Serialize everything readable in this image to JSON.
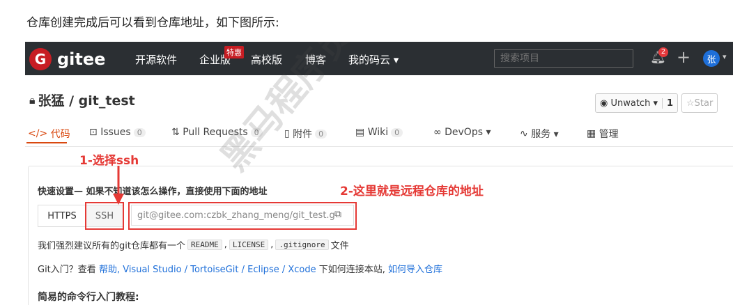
{
  "intro_text": "仓库创建完成后可以看到仓库地址，如下图所示:",
  "nav": {
    "logo_letter": "G",
    "logo_text": "gitee",
    "items": [
      "开源软件",
      "企业版",
      "高校版",
      "博客",
      "我的码云 ▾"
    ],
    "tag": "特惠",
    "search_placeholder": "搜索项目",
    "notification_count": "2",
    "avatar_letter": "张"
  },
  "repo": {
    "name": "张猛 / git_test",
    "watch_label": "Unwatch ▾",
    "watch_count": "1",
    "star_label": "Star"
  },
  "tabs": [
    {
      "label": "代码"
    },
    {
      "label": "Issues",
      "count": "0"
    },
    {
      "label": "Pull Requests",
      "count": "0"
    },
    {
      "label": "附件",
      "count": "0"
    },
    {
      "label": "Wiki",
      "count": "0"
    },
    {
      "label": "DevOps ▾"
    },
    {
      "label": "服务 ▾"
    },
    {
      "label": "管理"
    }
  ],
  "quick_setup": {
    "title": "快速设置— 如果不知道该怎么操作，直接使用下面的地址",
    "https_label": "HTTPS",
    "ssh_label": "SSH",
    "url": "git@gitee.com:czbk_zhang_meng/git_test.g",
    "suggest_prefix": "我们强烈建议所有的git仓库都有一个",
    "files": [
      "README",
      "LICENSE",
      ".gitignore"
    ],
    "suggest_suffix": "文件",
    "help_prefix": "Git入门？查看",
    "help_link": "帮助",
    "tools": ", Visual Studio / TortoiseGit / Eclipse / Xcode",
    "help_mid": "下如何连接本站,",
    "import_link": "如何导入仓库",
    "simple_title": "简易的命令行入门教程:"
  },
  "annotations": {
    "step1": "1-选择ssh",
    "step2": "2-这里就是远程仓库的地址"
  },
  "watermark": "黑马程序员",
  "colors": {
    "accent": "#e53935",
    "brand": "#c71d23",
    "nav_bg": "#2b2f33",
    "link": "#1e6fd9"
  }
}
